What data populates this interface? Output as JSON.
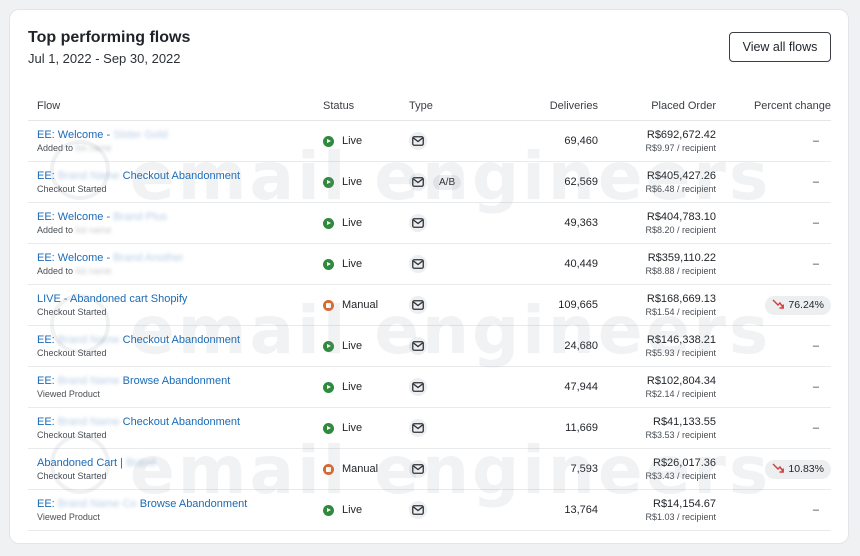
{
  "header": {
    "title": "Top performing flows",
    "date_range": "Jul 1, 2022 - Sep 30, 2022",
    "view_all_label": "View all flows"
  },
  "table": {
    "columns": {
      "flow": "Flow",
      "status": "Status",
      "type": "Type",
      "deliveries": "Deliveries",
      "placed_order": "Placed Order",
      "percent_change": "Percent change"
    },
    "rows": [
      {
        "name_prefix": "EE: Welcome - ",
        "name_blur": "Sister Gold",
        "name_suffix": "",
        "sub": "Added to ",
        "sub_blur": "list name",
        "status": "Live",
        "type_icon": "envelope-icon",
        "ab": "",
        "deliveries": "69,460",
        "order": "R$692,672.42",
        "per_recipient": "R$9.97 / recipient",
        "pct": "–",
        "pct_dir": ""
      },
      {
        "name_prefix": "EE: ",
        "name_blur": "Brand Name",
        "name_suffix": " Checkout Abandonment",
        "sub": "Checkout Started",
        "sub_blur": "",
        "status": "Live",
        "type_icon": "envelope-icon",
        "ab": "A/B",
        "deliveries": "62,569",
        "order": "R$405,427.26",
        "per_recipient": "R$6.48 / recipient",
        "pct": "–",
        "pct_dir": ""
      },
      {
        "name_prefix": "EE: Welcome - ",
        "name_blur": "Brand Plus",
        "name_suffix": "",
        "sub": "Added to ",
        "sub_blur": "list name",
        "status": "Live",
        "type_icon": "envelope-icon",
        "ab": "",
        "deliveries": "49,363",
        "order": "R$404,783.10",
        "per_recipient": "R$8.20 / recipient",
        "pct": "–",
        "pct_dir": ""
      },
      {
        "name_prefix": "EE: Welcome - ",
        "name_blur": "Brand Another",
        "name_suffix": "",
        "sub": "Added to ",
        "sub_blur": "list name",
        "status": "Live",
        "type_icon": "envelope-icon",
        "ab": "",
        "deliveries": "40,449",
        "order": "R$359,110.22",
        "per_recipient": "R$8.88 / recipient",
        "pct": "–",
        "pct_dir": ""
      },
      {
        "name_prefix": "LIVE - Abandoned cart Shopify",
        "name_blur": "",
        "name_suffix": "",
        "sub": "Checkout Started",
        "sub_blur": "",
        "status": "Manual",
        "type_icon": "envelope-icon",
        "ab": "",
        "deliveries": "109,665",
        "order": "R$168,669.13",
        "per_recipient": "R$1.54 / recipient",
        "pct": "76.24%",
        "pct_dir": "down"
      },
      {
        "name_prefix": "EE: ",
        "name_blur": "Brand Name",
        "name_suffix": " Checkout Abandonment",
        "sub": "Checkout Started",
        "sub_blur": "",
        "status": "Live",
        "type_icon": "envelope-icon",
        "ab": "",
        "deliveries": "24,680",
        "order": "R$146,338.21",
        "per_recipient": "R$5.93 / recipient",
        "pct": "–",
        "pct_dir": ""
      },
      {
        "name_prefix": "EE: ",
        "name_blur": "Brand Name",
        "name_suffix": " Browse Abandonment",
        "sub": "Viewed Product",
        "sub_blur": "",
        "status": "Live",
        "type_icon": "envelope-icon",
        "ab": "",
        "deliveries": "47,944",
        "order": "R$102,804.34",
        "per_recipient": "R$2.14 / recipient",
        "pct": "–",
        "pct_dir": ""
      },
      {
        "name_prefix": "EE: ",
        "name_blur": "Brand Name",
        "name_suffix": " Checkout Abandonment",
        "sub": "Checkout Started",
        "sub_blur": "",
        "status": "Live",
        "type_icon": "envelope-icon",
        "ab": "",
        "deliveries": "11,669",
        "order": "R$41,133.55",
        "per_recipient": "R$3.53 / recipient",
        "pct": "–",
        "pct_dir": ""
      },
      {
        "name_prefix": "Abandoned Cart | ",
        "name_blur": "Brand",
        "name_suffix": "",
        "sub": "Checkout Started",
        "sub_blur": "",
        "status": "Manual",
        "type_icon": "envelope-icon",
        "ab": "",
        "deliveries": "7,593",
        "order": "R$26,017.36",
        "per_recipient": "R$3.43 / recipient",
        "pct": "10.83%",
        "pct_dir": "down"
      },
      {
        "name_prefix": "EE: ",
        "name_blur": "Brand Name Co",
        "name_suffix": " Browse Abandonment",
        "sub": "Viewed Product",
        "sub_blur": "",
        "status": "Live",
        "type_icon": "envelope-icon",
        "ab": "",
        "deliveries": "13,764",
        "order": "R$14,154.67",
        "per_recipient": "R$1.03 / recipient",
        "pct": "–",
        "pct_dir": ""
      }
    ]
  },
  "watermark": {
    "text": "email engineers"
  },
  "colors": {
    "link": "#1a6bb8",
    "live": "#2f8a3e",
    "manual": "#d9682f",
    "decrease": "#d23c3c"
  }
}
